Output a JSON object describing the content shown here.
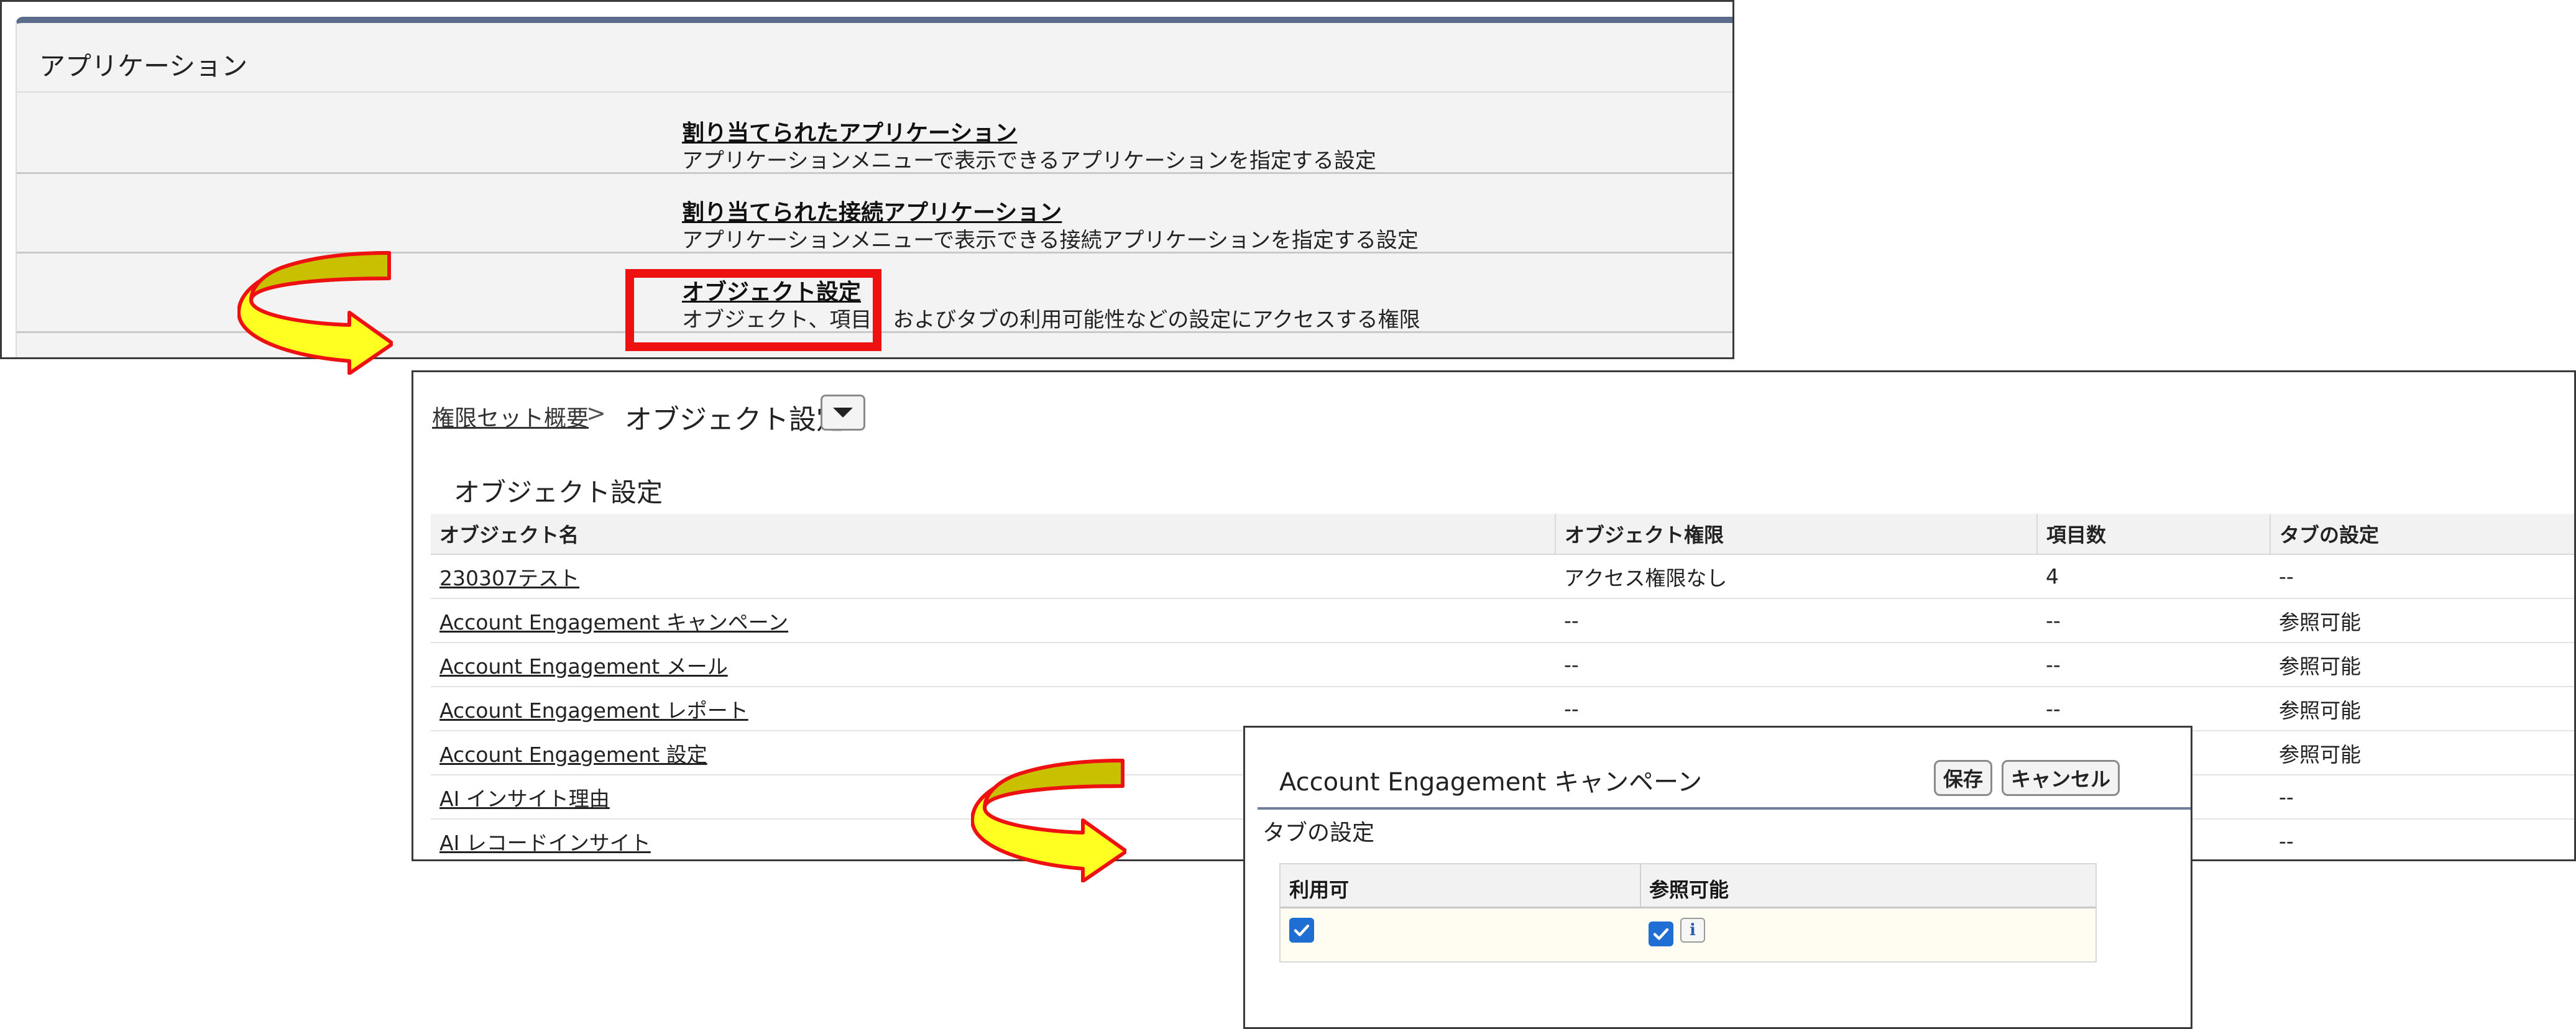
{
  "apps_panel": {
    "title": "アプリケーション",
    "items": [
      {
        "name": "割り当てられたアプリケーション",
        "desc": "アプリケーションメニューで表示できるアプリケーションを指定する設定"
      },
      {
        "name": "割り当てられた接続アプリケーション",
        "desc": "アプリケーションメニューで表示できる接続アプリケーションを指定する設定"
      },
      {
        "name": "オブジェクト設定",
        "desc": "オブジェクト、項目、およびタブの利用可能性などの設定にアクセスする権限"
      }
    ]
  },
  "objects_panel": {
    "breadcrumb_parent": "権限セット概要",
    "breadcrumb_sep": ">",
    "breadcrumb_current": "オブジェクト設定",
    "section_title": "オブジェクト設定",
    "columns": [
      "オブジェクト名",
      "オブジェクト権限",
      "項目数",
      "タブの設定"
    ],
    "rows": [
      [
        "230307テスト",
        "アクセス権限なし",
        "4",
        "--"
      ],
      [
        "Account Engagement キャンペーン",
        "--",
        "--",
        "参照可能"
      ],
      [
        "Account Engagement メール",
        "--",
        "--",
        "参照可能"
      ],
      [
        "Account Engagement レポート",
        "--",
        "--",
        "参照可能"
      ],
      [
        "Account Engagement 設定",
        "",
        "",
        "参照可能"
      ],
      [
        "AI インサイト理由",
        "",
        "",
        "--"
      ],
      [
        "AI レコードインサイト",
        "",
        "",
        "--"
      ]
    ]
  },
  "tab_dialog": {
    "title": "Account Engagement キャンペーン",
    "save_label": "保存",
    "cancel_label": "キャンセル",
    "section_title": "タブの設定",
    "col_available": "利用可",
    "col_visible": "参照可能",
    "available_checked": true,
    "visible_checked": true,
    "info_glyph": "i"
  },
  "colors": {
    "highlight": "#ee1111",
    "arrow_fill": "#ffff22",
    "arrow_top": "#c8c000",
    "checkbox": "#1f6ed4"
  }
}
